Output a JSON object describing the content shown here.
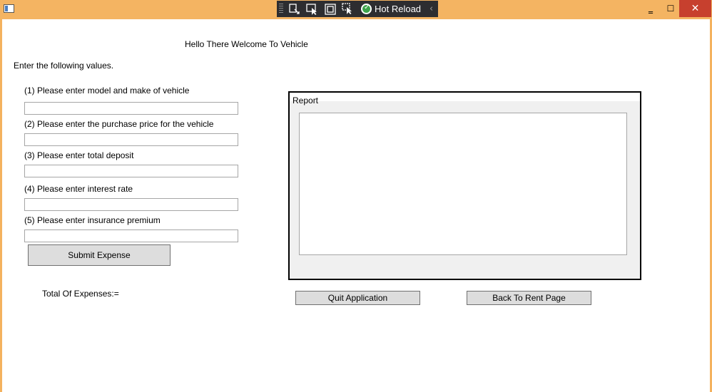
{
  "titlebar": {
    "hot_reload_label": "Hot Reload",
    "window_buttons": {
      "minimize": "‗",
      "maximize": "☐",
      "close": "✕"
    }
  },
  "main": {
    "heading": "Hello There Welcome To Vehicle",
    "instructions": "Enter the following values.",
    "fields": [
      {
        "label": "(1) Please enter model and make of vehicle",
        "value": ""
      },
      {
        "label": "(2) Please enter the purchase price for the vehicle",
        "value": ""
      },
      {
        "label": "(3) Please enter total deposit",
        "value": ""
      },
      {
        "label": "(4) Please enter interest rate",
        "value": ""
      },
      {
        "label": "(5) Please enter insurance premium",
        "value": ""
      }
    ],
    "submit_button": "Submit Expense",
    "total_label": "Total Of Expenses:=",
    "report": {
      "label": "Report",
      "text": ""
    },
    "quit_button": "Quit Application",
    "back_button": "Back To Rent Page"
  }
}
